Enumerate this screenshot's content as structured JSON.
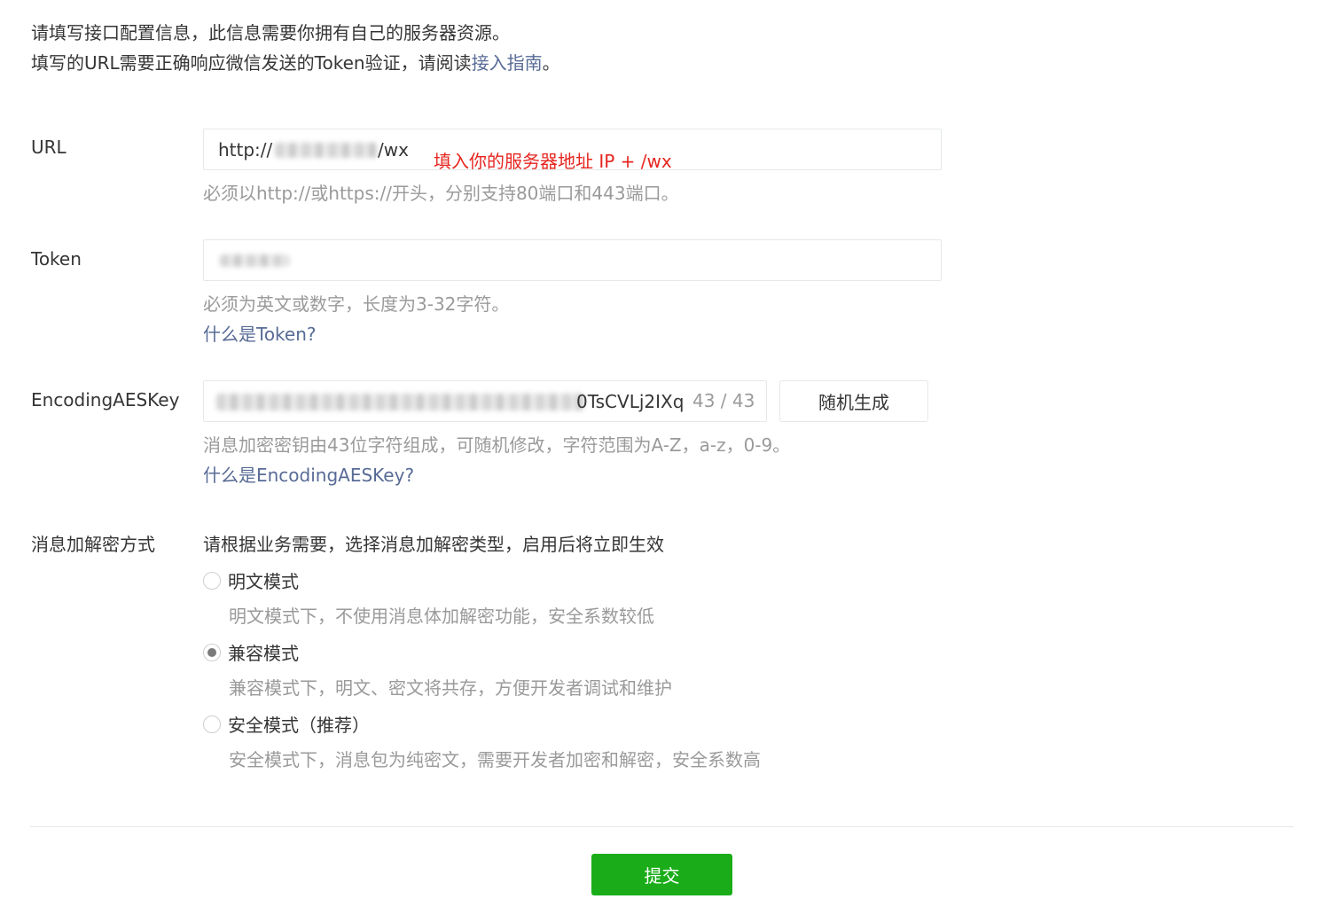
{
  "intro": {
    "line1": "请填写接口配置信息，此信息需要你拥有自己的服务器资源。",
    "line2_prefix": "填写的URL需要正确响应微信发送的Token验证，请阅读",
    "line2_link": "接入指南",
    "line2_suffix": "。"
  },
  "url": {
    "label": "URL",
    "value_prefix": "http://",
    "value_suffix": "/wx",
    "annotation": "填入你的服务器地址 IP + /wx",
    "hint": "必须以http://或https://开头，分别支持80端口和443端口。"
  },
  "token": {
    "label": "Token",
    "hint": "必须为英文或数字，长度为3-32字符。",
    "help_link": "什么是Token?"
  },
  "aeskey": {
    "label": "EncodingAESKey",
    "value_visible": "0TsCVLj2IXq",
    "counter": "43 / 43",
    "random_button": "随机生成",
    "hint": "消息加密密钥由43位字符组成，可随机修改，字符范围为A-Z，a-z，0-9。",
    "help_link": "什么是EncodingAESKey?"
  },
  "encryption": {
    "label": "消息加解密方式",
    "description": "请根据业务需要，选择消息加解密类型，启用后将立即生效",
    "options": [
      {
        "label": "明文模式",
        "hint": "明文模式下，不使用消息体加解密功能，安全系数较低",
        "checked": false
      },
      {
        "label": "兼容模式",
        "hint": "兼容模式下，明文、密文将共存，方便开发者调试和维护",
        "checked": true
      },
      {
        "label": "安全模式（推荐）",
        "hint": "安全模式下，消息包为纯密文，需要开发者加密和解密，安全系数高",
        "checked": false
      }
    ]
  },
  "submit_label": "提交",
  "colors": {
    "link": "#576b95",
    "annotation": "#e6261f",
    "primary_button": "#1aad19",
    "hint_text": "#9a9a9a"
  }
}
